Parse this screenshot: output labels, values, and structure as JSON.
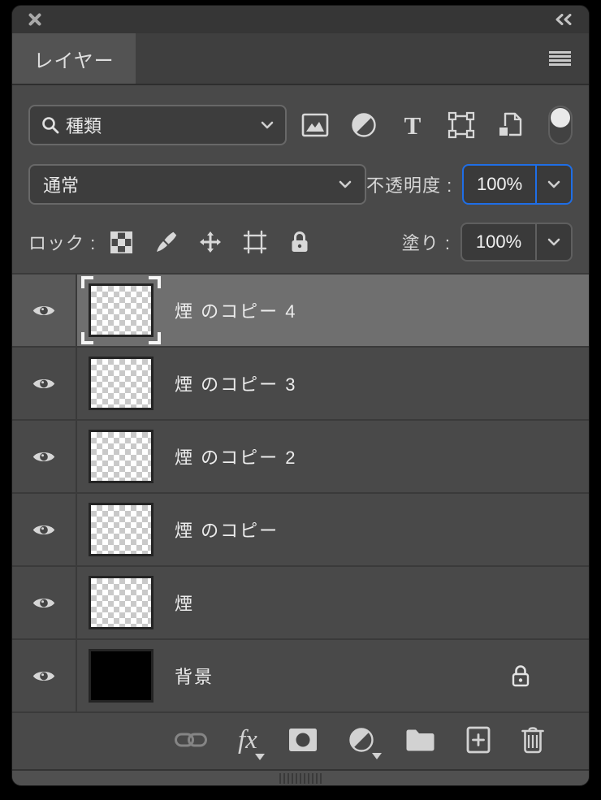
{
  "window": {
    "close_label": "close",
    "collapse_label": "collapse"
  },
  "tabbar": {
    "active_tab": "レイヤー"
  },
  "filter_row": {
    "search_label": "種類",
    "icons": [
      "pixel-layer-filter",
      "adjustment-layer-filter",
      "type-layer-filter",
      "shape-layer-filter",
      "smart-object-filter"
    ],
    "toggle_state": "on"
  },
  "blend_row": {
    "blend_mode": "通常",
    "opacity_label": "不透明度 :",
    "opacity_value": "100%"
  },
  "lock_row": {
    "label": "ロック :",
    "icons": [
      "lock-transparent-pixels",
      "lock-image-pixels",
      "lock-position",
      "lock-artboard",
      "lock-all"
    ],
    "fill_label": "塗り :",
    "fill_value": "100%"
  },
  "layers": [
    {
      "name": "煙 のコピー 4",
      "selected": true,
      "visible": true,
      "thumb": "transparent-checker"
    },
    {
      "name": "煙 のコピー 3",
      "selected": false,
      "visible": true,
      "thumb": "transparent-checker"
    },
    {
      "name": "煙 のコピー 2",
      "selected": false,
      "visible": true,
      "thumb": "transparent-checker"
    },
    {
      "name": "煙 のコピー",
      "selected": false,
      "visible": true,
      "thumb": "transparent-checker"
    },
    {
      "name": "煙",
      "selected": false,
      "visible": true,
      "thumb": "transparent-checker"
    },
    {
      "name": "背景",
      "selected": false,
      "visible": true,
      "locked": true,
      "thumb": "black"
    }
  ],
  "toolbar_icons": [
    "link-layers",
    "layer-effects",
    "add-layer-mask",
    "new-adjustment-layer",
    "new-group",
    "new-layer",
    "delete-layer"
  ],
  "colors": {
    "accent_blue": "#1f6ee6",
    "panel_bg": "#494949",
    "selected_row": "#6f6f6f",
    "titlebar": "#363636"
  }
}
